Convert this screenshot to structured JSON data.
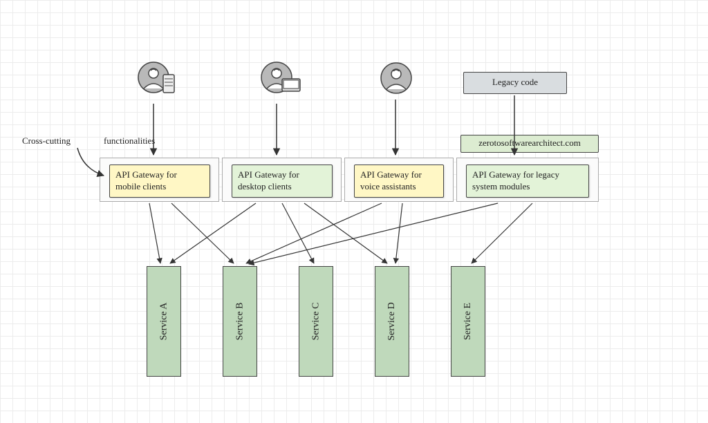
{
  "annotations": {
    "cross_cutting": "Cross-cutting",
    "functionalities": "functionalities"
  },
  "clients": {
    "mobile": "mobile-user",
    "desktop": "desktop-user",
    "voice": "voice-user",
    "legacy_label": "Legacy code"
  },
  "watermark": "zerotosoftwarearchitect.com",
  "gateways": {
    "mobile": "API Gateway for mobile clients",
    "desktop": "API Gateway for desktop clients",
    "voice": "API Gateway for voice assistants",
    "legacy": "API Gateway for legacy system modules"
  },
  "services": [
    "Service A",
    "Service B",
    "Service C",
    "Service D",
    "Service E"
  ],
  "connections": [
    {
      "from": "mobile",
      "to": [
        "Service A",
        "Service B"
      ]
    },
    {
      "from": "desktop",
      "to": [
        "Service A",
        "Service C",
        "Service D"
      ]
    },
    {
      "from": "voice",
      "to": [
        "Service B",
        "Service D"
      ]
    },
    {
      "from": "legacy",
      "to": [
        "Service B",
        "Service E"
      ]
    }
  ],
  "colors": {
    "gateway_yellow": "#fff7c5",
    "gateway_green": "#e3f3d8",
    "service_green": "#bfd9bb",
    "legacy_gray": "#d9dde0",
    "watermark": "#dcecd1",
    "stroke": "#333333"
  }
}
